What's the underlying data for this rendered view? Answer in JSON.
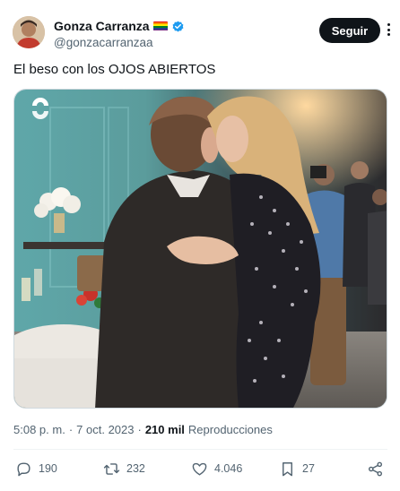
{
  "author": {
    "display_name": "Gonza Carranza",
    "handle": "@gonzacarranzaa",
    "flag_icon": "rainbow-flag-icon",
    "verified_icon": "verified-badge-icon"
  },
  "follow_label": "Seguir",
  "tweet": {
    "text": "El beso con los OJOS ABIERTOS"
  },
  "meta": {
    "time": "5:08 p. m.",
    "separator": "·",
    "date": "7 oct. 2023",
    "views_count": "210 mil",
    "views_label": "Reproducciones"
  },
  "actions": {
    "replies": "190",
    "reposts": "232",
    "likes": "4.046",
    "bookmarks": "27"
  },
  "colors": {
    "text": "#0f1419",
    "secondary": "#536471",
    "verified": "#1d9bf0",
    "border": "#cfd9de"
  }
}
